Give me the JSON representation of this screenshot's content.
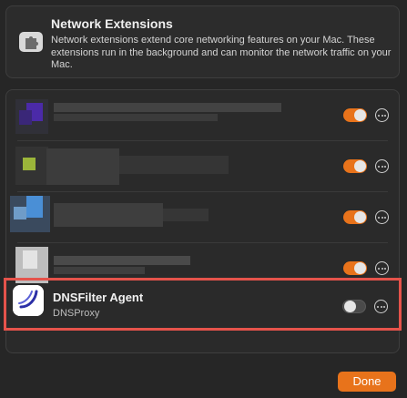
{
  "header": {
    "title": "Network Extensions",
    "description": "Network extensions extend core networking features on your Mac. These extensions run in the background and can monitor the network traffic on your Mac.",
    "icon": "puzzle-extension-icon"
  },
  "extensions": [
    {
      "name": "",
      "subtitle": "",
      "enabled": true,
      "obscured": true,
      "icon_color": "#4b2aa8"
    },
    {
      "name": "",
      "subtitle": "",
      "enabled": true,
      "obscured": true,
      "icon_color": "#9bb53a"
    },
    {
      "name": "",
      "subtitle": "",
      "enabled": true,
      "obscured": true,
      "icon_color": "#4a8fd6"
    },
    {
      "name": "",
      "subtitle": "",
      "enabled": true,
      "obscured": true,
      "icon_color": "#e4e4e4"
    },
    {
      "name": "DNSFilter Agent",
      "subtitle": "DNSProxy",
      "enabled": false,
      "obscured": false,
      "icon": "dnsfilter-logo-icon",
      "icon_color": "#2b2fa6"
    }
  ],
  "footer": {
    "done_label": "Done"
  },
  "colors": {
    "accent": "#e8731b",
    "highlight": "#e5534b"
  }
}
